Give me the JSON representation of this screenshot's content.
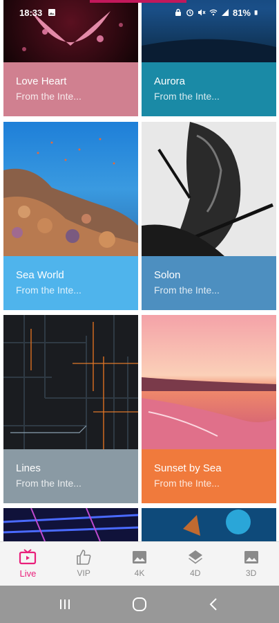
{
  "status_bar": {
    "time": "18:33",
    "battery": "81%",
    "icons": [
      "image-icon",
      "lock-icon",
      "alarm-icon",
      "mute-icon",
      "wifi-icon",
      "signal-icon",
      "battery-icon"
    ]
  },
  "cards": [
    {
      "title": "Love Heart",
      "subtitle": "From the Inte...",
      "color": "#d08090"
    },
    {
      "title": "Aurora",
      "subtitle": "From the Inte...",
      "color": "#1a8aa6"
    },
    {
      "title": "Sea World",
      "subtitle": "From the Inte...",
      "color": "#4fb4ec"
    },
    {
      "title": "Solon",
      "subtitle": "From the Inte...",
      "color": "#4d8fc0"
    },
    {
      "title": "Lines",
      "subtitle": "From the Inte...",
      "color": "#8a9aa4"
    },
    {
      "title": "Sunset by Sea",
      "subtitle": "From the Inte...",
      "color": "#f07a3c"
    }
  ],
  "bottom_nav": [
    {
      "label": "Live",
      "icon": "tv-icon",
      "active": true
    },
    {
      "label": "VIP",
      "icon": "thumbs-up-icon",
      "active": false
    },
    {
      "label": "4K",
      "icon": "image-icon",
      "active": false
    },
    {
      "label": "4D",
      "icon": "layers-icon",
      "active": false
    },
    {
      "label": "3D",
      "icon": "image-icon",
      "active": false
    }
  ],
  "colors": {
    "accent": "#e91e7a",
    "nav_inactive": "#8a8a8a",
    "system_nav_bg": "#989898"
  }
}
